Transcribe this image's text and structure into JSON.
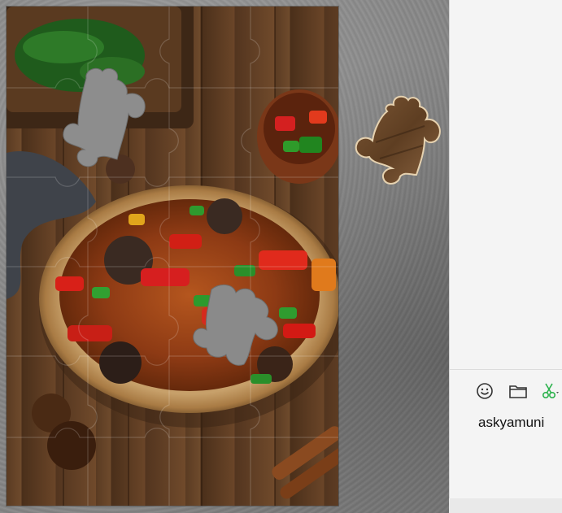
{
  "puzzle": {
    "board_image": "food-bowl-photo",
    "loose_piece_count": 1,
    "missing_hole_count": 2
  },
  "chat": {
    "toolbar": {
      "emoji_icon": "smiley-icon",
      "folder_icon": "folder-icon",
      "scissors_icon": "scissors-icon"
    },
    "input_text": "askyamuni"
  },
  "colors": {
    "panel_bg": "#f4f4f4",
    "scissors_green": "#2bb24c",
    "icon_gray": "#333333"
  }
}
